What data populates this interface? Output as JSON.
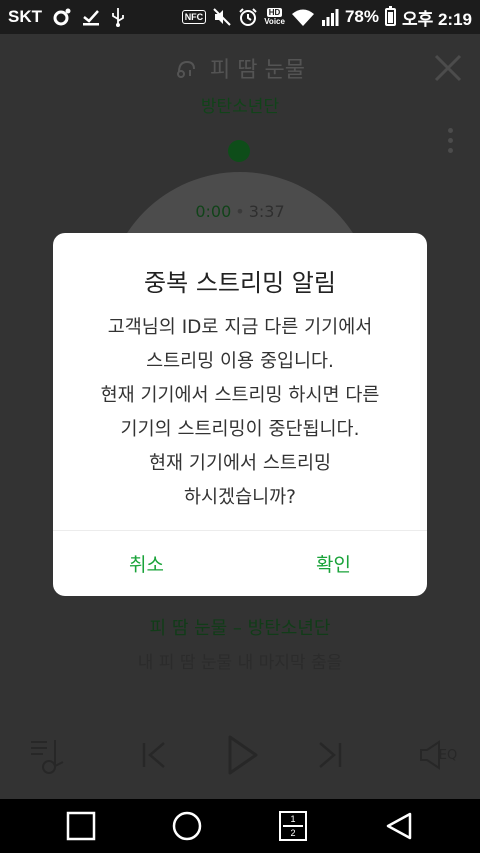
{
  "status_bar": {
    "carrier": "SKT",
    "nfc": "NFC",
    "hd_label": "HD",
    "voice_label": "Voice",
    "battery": "78%",
    "time": "오후 2:19"
  },
  "player": {
    "song_title": "피 땀 눈물",
    "artist": "방탄소년단",
    "time_current": "0:00",
    "time_total": "3:37",
    "now_playing_line": "피 땀 눈물 – 방탄소년단",
    "lyric": "내 피 땀 눈물 내 마지막 춤을",
    "eq_label": "EQ"
  },
  "dialog": {
    "title": "중복 스트리밍 알림",
    "message_lines": [
      "고객님의 ID로 지금 다른 기기에서",
      "스트리밍 이용 중입니다.",
      "현재 기기에서 스트리밍 하시면 다른",
      "기기의 스트리밍이 중단됩니다.",
      "현재 기기에서 스트리밍",
      "하시겠습니까?"
    ],
    "cancel_label": "취소",
    "ok_label": "확인"
  },
  "nav_bar": {
    "split_top": "1",
    "split_bottom": "2"
  },
  "colors": {
    "accent_green": "#1aa33a",
    "dim_green": "#1f7a2f"
  }
}
